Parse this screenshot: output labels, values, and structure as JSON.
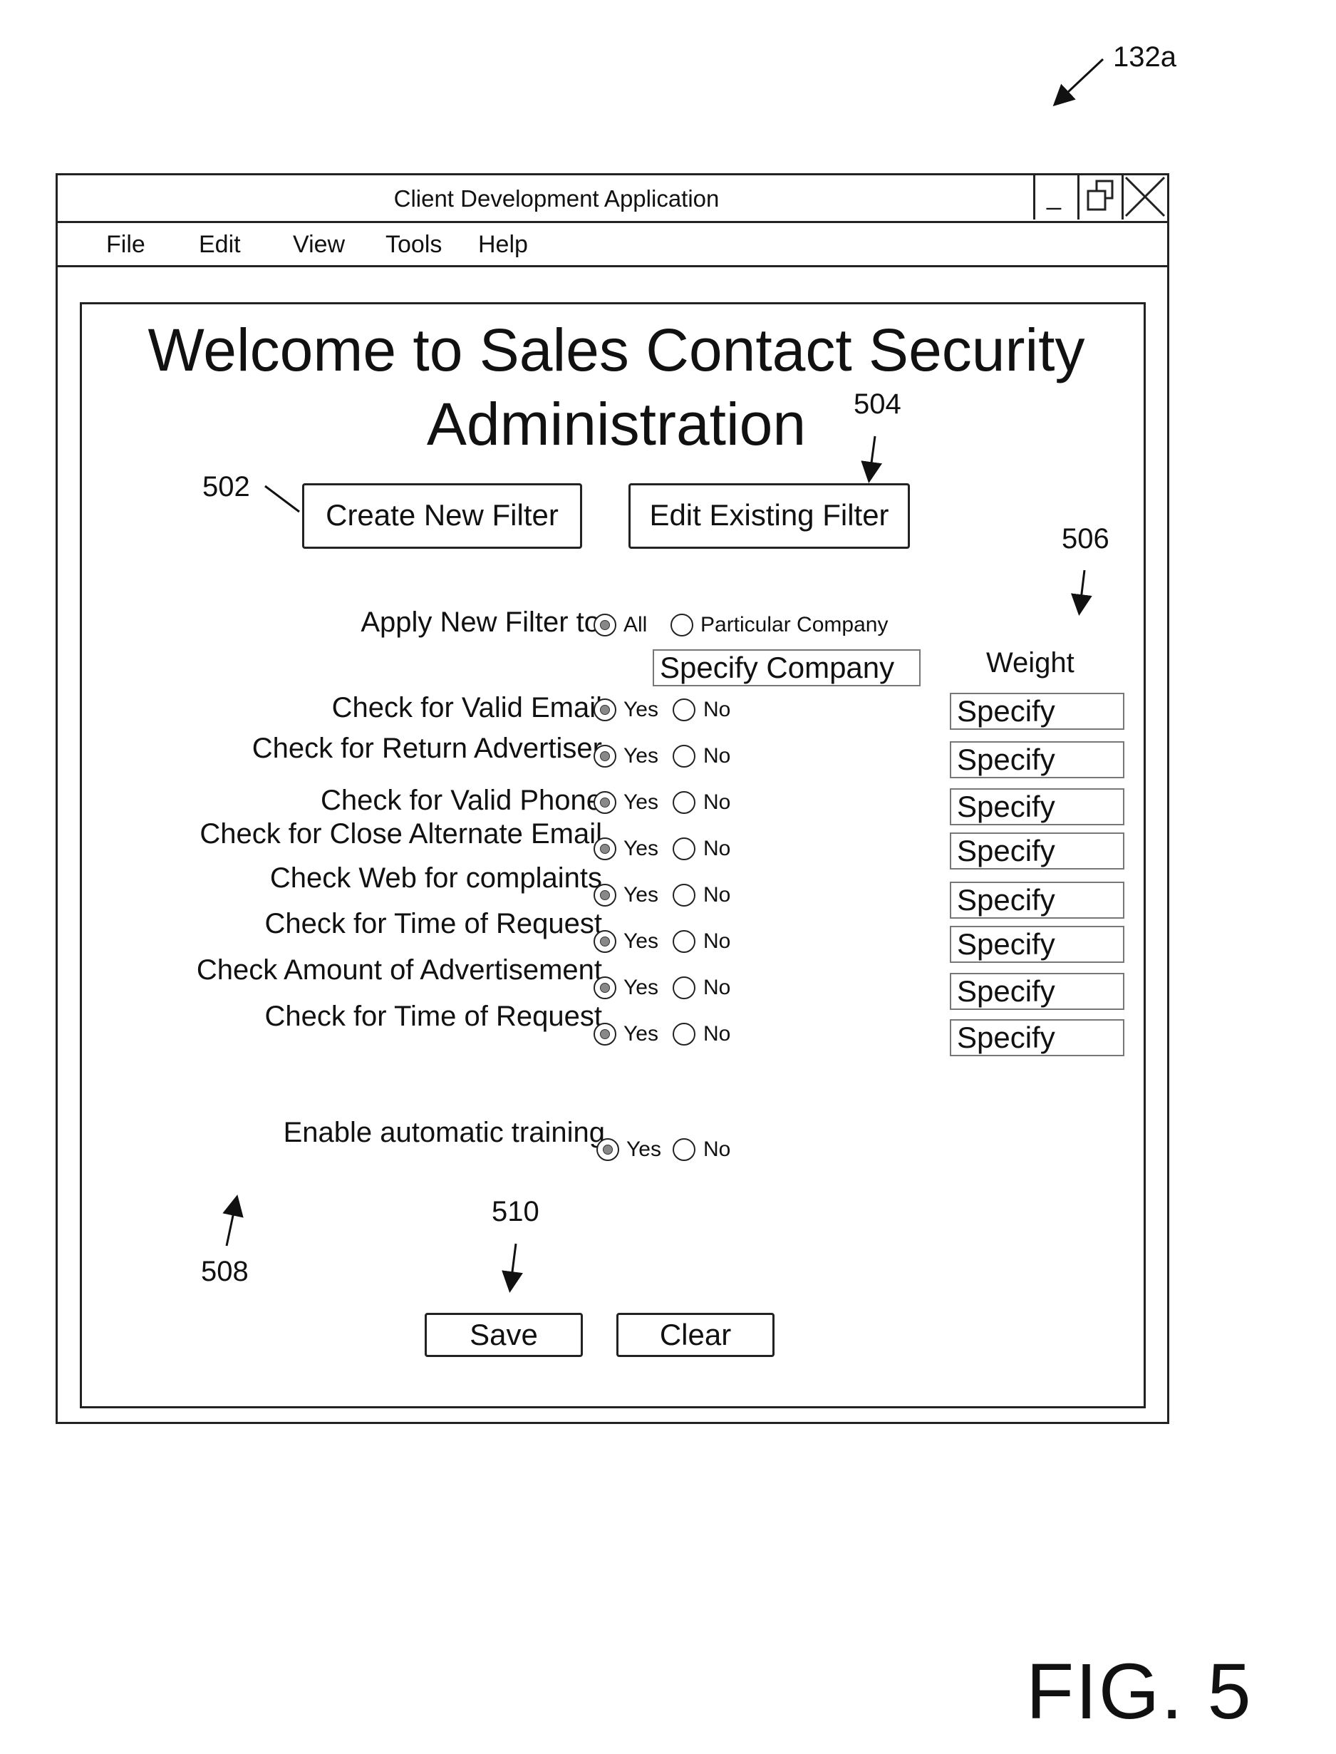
{
  "refs": {
    "figure_ref": "132a",
    "create_filter_ref": "502",
    "edit_filter_ref": "504",
    "weight_ref": "506",
    "training_ref": "508",
    "save_ref": "510"
  },
  "figure_label": "FIG. 5",
  "window": {
    "title": "Client Development Application",
    "controls": {
      "minimize_glyph": "_"
    }
  },
  "menu": [
    "File",
    "Edit",
    "View",
    "Tools",
    "Help"
  ],
  "heading": {
    "line1": "Welcome to Sales Contact Security",
    "line2": "Administration"
  },
  "buttons": {
    "create_filter": "Create New Filter",
    "edit_filter": "Edit Existing Filter",
    "save": "Save",
    "clear": "Clear"
  },
  "apply": {
    "label": "Apply New Filter to",
    "option_all": "All",
    "option_particular": "Particular Company",
    "selected": "All",
    "company_field": "Specify Company"
  },
  "weight_header": "Weight",
  "checks": [
    {
      "label": "Check for Valid Email",
      "yes": "Yes",
      "no": "No",
      "selected": "Yes",
      "weight": "Specify"
    },
    {
      "label": "Check for Return Advertiser",
      "yes": "Yes",
      "no": "No",
      "selected": "Yes",
      "weight": "Specify"
    },
    {
      "label": "Check for Valid Phone",
      "yes": "Yes",
      "no": "No",
      "selected": "Yes",
      "weight": "Specify"
    },
    {
      "label": "Check for Close Alternate Email",
      "yes": "Yes",
      "no": "No",
      "selected": "Yes",
      "weight": "Specify"
    },
    {
      "label": "Check Web for complaints",
      "yes": "Yes",
      "no": "No",
      "selected": "Yes",
      "weight": "Specify"
    },
    {
      "label": "Check for Time of Request",
      "yes": "Yes",
      "no": "No",
      "selected": "Yes",
      "weight": "Specify"
    },
    {
      "label": "Check Amount of Advertisement",
      "yes": "Yes",
      "no": "No",
      "selected": "Yes",
      "weight": "Specify"
    },
    {
      "label": "Check for Time of Request",
      "yes": "Yes",
      "no": "No",
      "selected": "Yes",
      "weight": "Specify"
    }
  ],
  "training": {
    "label": "Enable automatic training",
    "yes": "Yes",
    "no": "No",
    "selected": "Yes"
  }
}
